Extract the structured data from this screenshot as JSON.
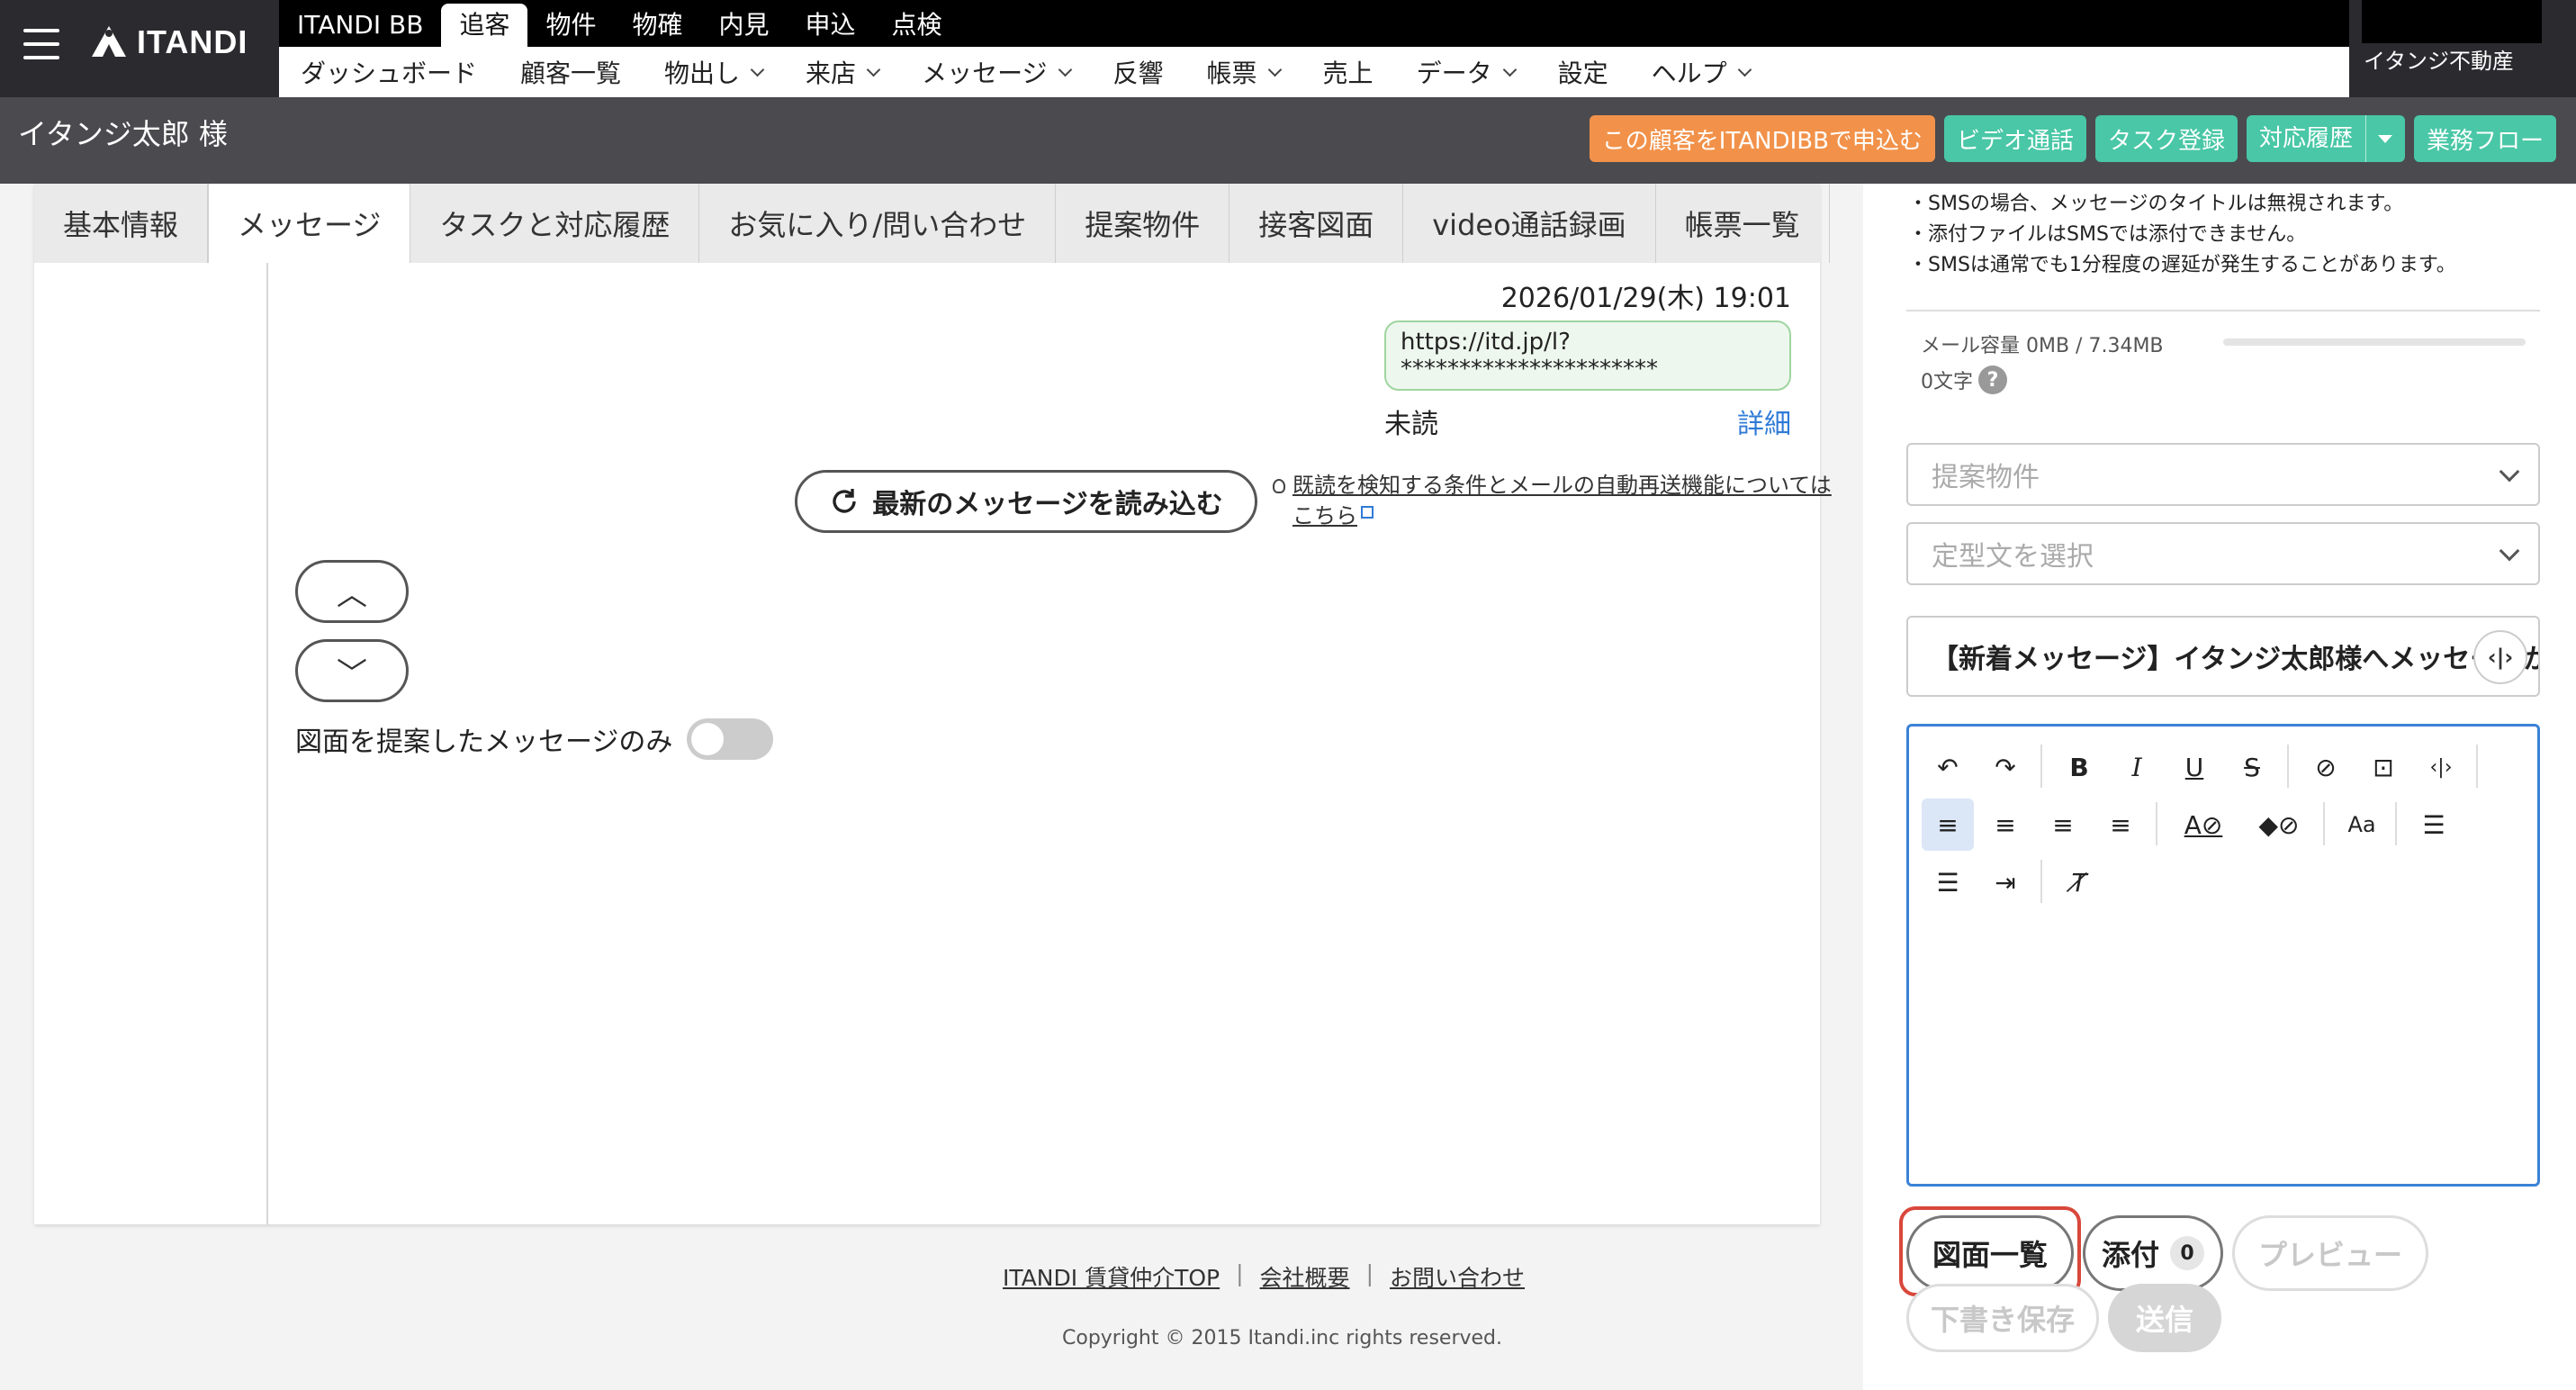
{
  "header": {
    "logo_text": "ITANDI",
    "account_label": "イタンジ不動産",
    "nav_top": [
      "ITANDI BB",
      "追客",
      "物件",
      "物確",
      "内見",
      "申込",
      "点検"
    ],
    "nav_top_active": "追客",
    "nav_sub": [
      {
        "label": "ダッシュボード",
        "dropdown": false
      },
      {
        "label": "顧客一覧",
        "dropdown": false
      },
      {
        "label": "物出し",
        "dropdown": true
      },
      {
        "label": "来店",
        "dropdown": true
      },
      {
        "label": "メッセージ",
        "dropdown": true
      },
      {
        "label": "反響",
        "dropdown": false
      },
      {
        "label": "帳票",
        "dropdown": true
      },
      {
        "label": "売上",
        "dropdown": false
      },
      {
        "label": "データ",
        "dropdown": true
      },
      {
        "label": "設定",
        "dropdown": false
      },
      {
        "label": "ヘルプ",
        "dropdown": true
      }
    ]
  },
  "customer": {
    "name": "イタンジ太郎 様",
    "actions": {
      "apply": "この顧客をITANDIBBで申込む",
      "video_call": "ビデオ通話",
      "task_register": "タスク登録",
      "history": "対応履歴",
      "workflow": "業務フロー"
    },
    "colors": {
      "orange": "#f2924a",
      "teal": "#49c7a6"
    }
  },
  "tabs": [
    "基本情報",
    "メッセージ",
    "タスクと対応履歴",
    "お気に入り/問い合わせ",
    "提案物件",
    "接客図面",
    "video通話録画",
    "帳票一覧"
  ],
  "active_tab": "メッセージ",
  "messages": {
    "date": "2026/01/29(木) 19:01",
    "bubble_text": "https://itd.jp/l?**********************",
    "status": "未読",
    "detail_link": "詳細",
    "reload_button": "最新のメッセージを読み込む",
    "hint_text": "既読を検知する条件とメールの自動再送機能についてはこちら",
    "up_button": "︿",
    "down_button": "﹀",
    "toggle_label": "図面を提案したメッセージのみ",
    "toggle_on": false
  },
  "footer": {
    "links": [
      "ITANDI 賃貸仲介TOP",
      "会社概要",
      "お問い合わせ"
    ],
    "copyright": "Copyright © 2015 Itandi.inc rights reserved."
  },
  "compose": {
    "notes": [
      "・SMSの場合、メッセージのタイトルは無視されます。",
      "・添付ファイルはSMSでは添付できません。",
      "・SMSは通常でも1分程度の遅延が発生することがあります。"
    ],
    "capacity_text": "メール容量 0MB / 7.34MB",
    "capacity_fraction": 0,
    "char_count": "0文字",
    "help_icon": "?",
    "property_placeholder": "提案物件",
    "template_placeholder": "定型文を選択",
    "subject": "【新着メッセージ】イタンジ太郎様へメッセージが届いています",
    "buttons": {
      "drawings": "図面一覧",
      "attach": "添付",
      "attach_count": "0",
      "preview": "プレビュー",
      "save_draft": "下書き保存",
      "send": "送信"
    },
    "highlight_color": "#d9473b"
  }
}
